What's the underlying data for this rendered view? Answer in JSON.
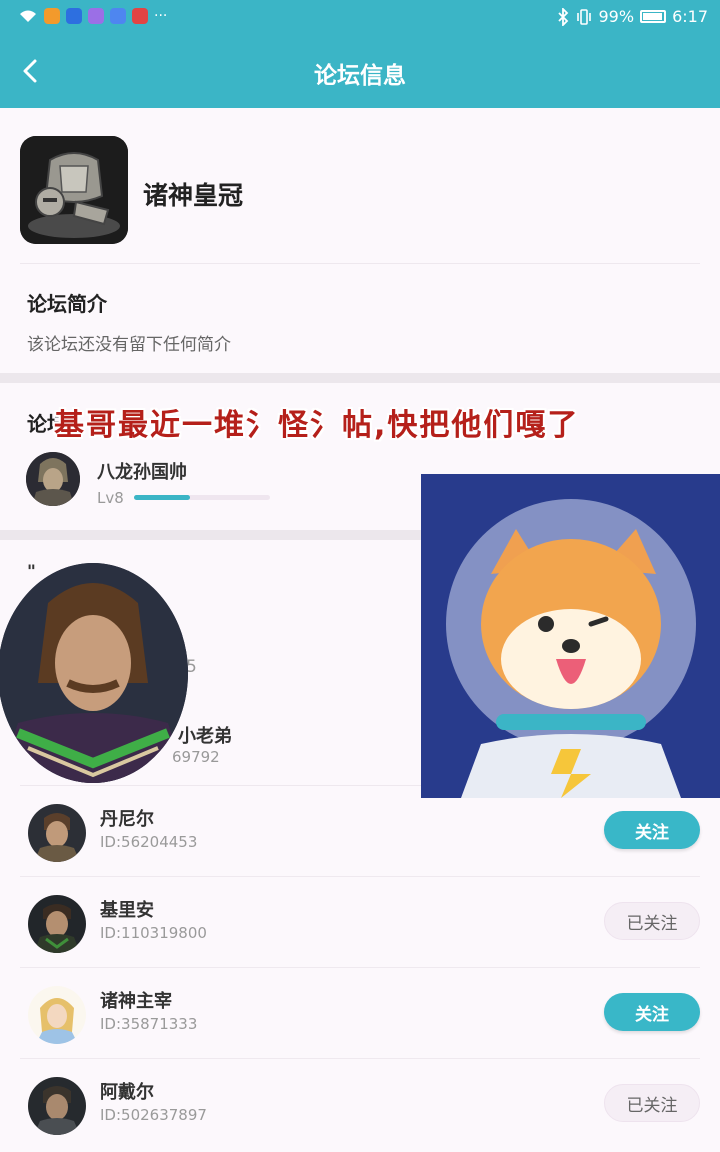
{
  "status_bar": {
    "battery_percent": "99%",
    "time": "6:17",
    "overflow_dots": "···"
  },
  "header": {
    "title": "论坛信息"
  },
  "forum": {
    "name": "诸神皇冠",
    "intro_title": "论坛简介",
    "intro_text": "该论坛还没有留下任何简介"
  },
  "moderator_section": {
    "title_visible": "论坛",
    "moderator": {
      "name": "八龙孙国帅",
      "level": "Lv8",
      "level_progress": 0.41
    }
  },
  "overlay": {
    "caption": "基哥最近一堆氵怪氵帖,快把他们嘎了"
  },
  "members_partial": {
    "section_title_fragment": "\"",
    "id_fragment": "5",
    "name_fragment": "小老弟",
    "id_fragment_2": "69792"
  },
  "members": [
    {
      "name": "丹尼尔",
      "id": "ID:56204453",
      "button": "关注",
      "followed": false
    },
    {
      "name": "基里安",
      "id": "ID:110319800",
      "button": "已关注",
      "followed": true
    },
    {
      "name": "诸神主宰",
      "id": "ID:35871333",
      "button": "关注",
      "followed": false
    },
    {
      "name": "阿戴尔",
      "id": "ID:502637897",
      "button": "已关注",
      "followed": true
    }
  ],
  "colors": {
    "accent": "#3bb5c6",
    "follow_button": "#39b7c8",
    "caption_red": "#b5201a"
  }
}
